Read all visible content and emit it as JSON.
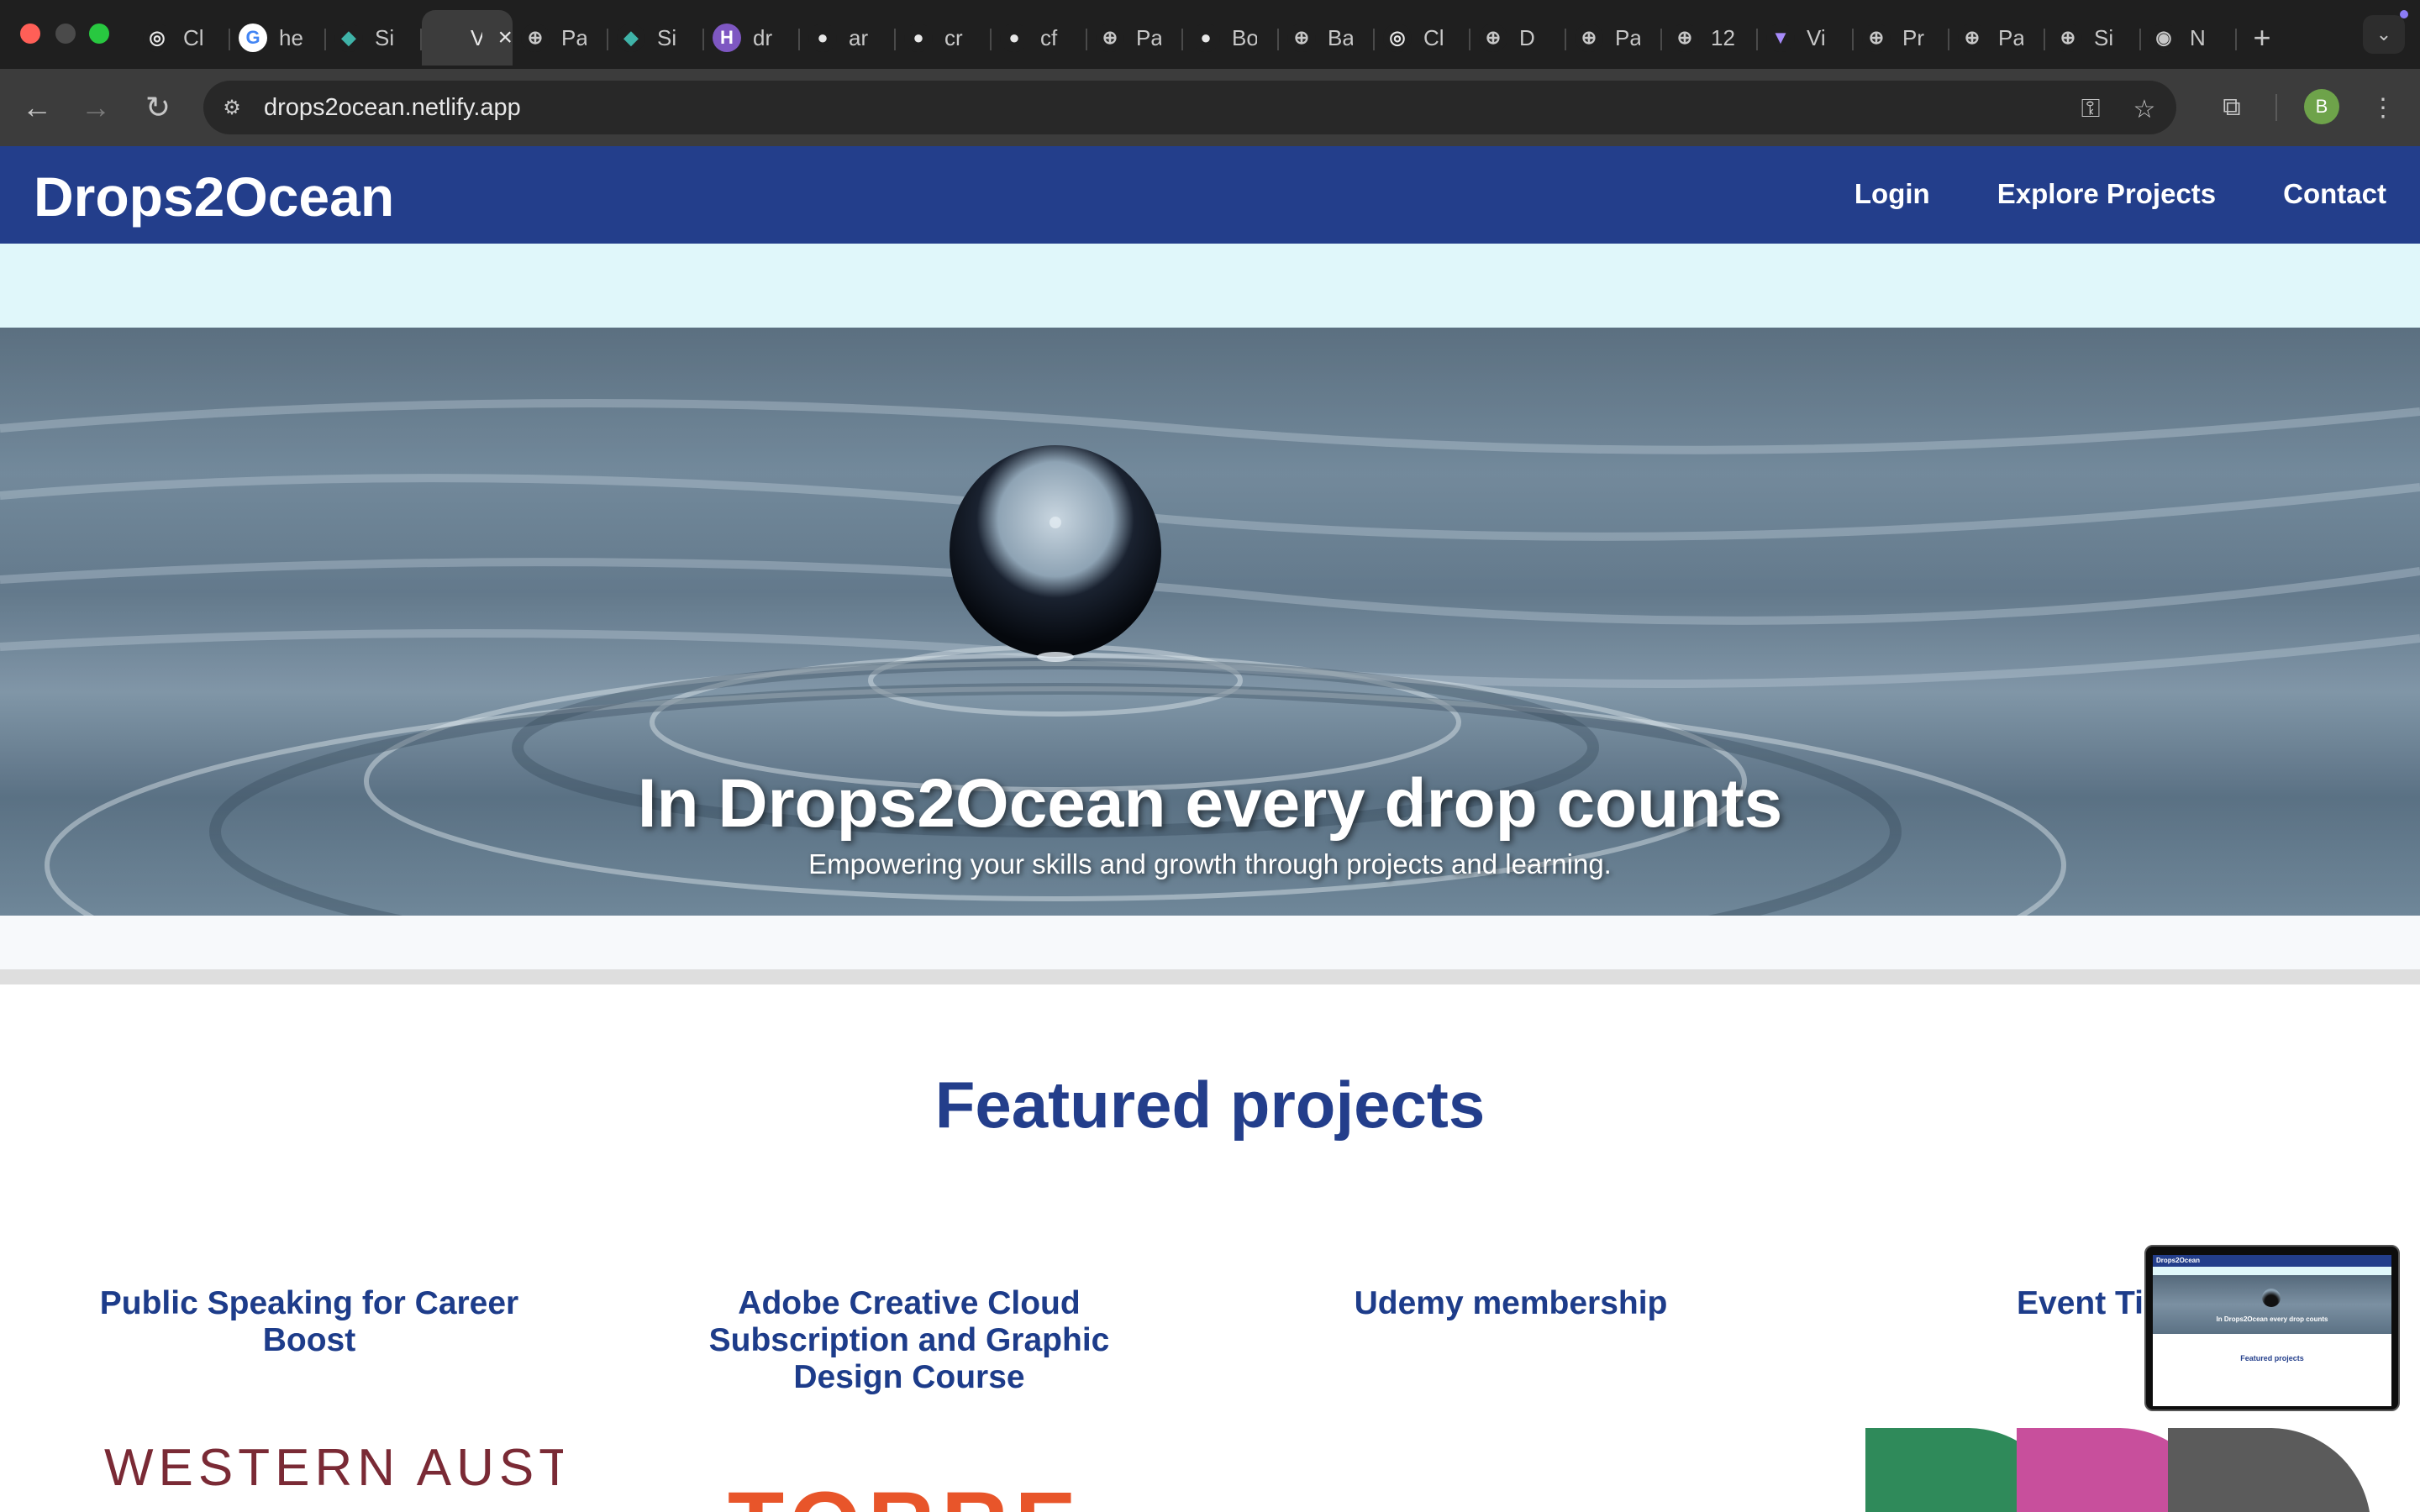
{
  "browser": {
    "tabs": [
      {
        "icon": "openai-icon",
        "glyph": "◎",
        "fav_bg": "#1f1f1f",
        "fav_color": "#e8e8e8",
        "title": "Cl"
      },
      {
        "icon": "google-icon",
        "glyph": "G",
        "fav_bg": "#ffffff",
        "fav_color": "#4285f4",
        "title": "he"
      },
      {
        "icon": "diamond-icon",
        "glyph": "◆",
        "fav_bg": "#1f1f1f",
        "fav_color": "#3fb3a8",
        "title": "Si"
      },
      {
        "icon": "vercel-icon",
        "glyph": "",
        "fav_bg": "#3c3c3c",
        "fav_color": "#e8e8e8",
        "title": "Vi",
        "active": true
      },
      {
        "icon": "globe-icon",
        "glyph": "⊕",
        "fav_bg": "#1f1f1f",
        "fav_color": "#c7c7c7",
        "title": "Pa"
      },
      {
        "icon": "diamond-icon",
        "glyph": "◆",
        "fav_bg": "#1f1f1f",
        "fav_color": "#3fb3a8",
        "title": "Si"
      },
      {
        "icon": "h-app-icon",
        "glyph": "H",
        "fav_bg": "#7e57c2",
        "fav_color": "#ffffff",
        "title": "dr"
      },
      {
        "icon": "github-icon",
        "glyph": "●",
        "fav_bg": "#1f1f1f",
        "fav_color": "#e8e8e8",
        "title": "ar"
      },
      {
        "icon": "github-icon",
        "glyph": "●",
        "fav_bg": "#1f1f1f",
        "fav_color": "#e8e8e8",
        "title": "cr"
      },
      {
        "icon": "github-icon",
        "glyph": "●",
        "fav_bg": "#1f1f1f",
        "fav_color": "#e8e8e8",
        "title": "cf"
      },
      {
        "icon": "globe-icon",
        "glyph": "⊕",
        "fav_bg": "#1f1f1f",
        "fav_color": "#c7c7c7",
        "title": "Pa"
      },
      {
        "icon": "github-icon",
        "glyph": "●",
        "fav_bg": "#1f1f1f",
        "fav_color": "#e8e8e8",
        "title": "Bo"
      },
      {
        "icon": "globe-icon",
        "glyph": "⊕",
        "fav_bg": "#1f1f1f",
        "fav_color": "#c7c7c7",
        "title": "Ba"
      },
      {
        "icon": "openai-icon",
        "glyph": "◎",
        "fav_bg": "#1f1f1f",
        "fav_color": "#e8e8e8",
        "title": "Cl"
      },
      {
        "icon": "globe-icon",
        "glyph": "⊕",
        "fav_bg": "#1f1f1f",
        "fav_color": "#c7c7c7",
        "title": "D"
      },
      {
        "icon": "globe-icon",
        "glyph": "⊕",
        "fav_bg": "#1f1f1f",
        "fav_color": "#c7c7c7",
        "title": "Pa"
      },
      {
        "icon": "globe-icon",
        "glyph": "⊕",
        "fav_bg": "#1f1f1f",
        "fav_color": "#c7c7c7",
        "title": "12"
      },
      {
        "icon": "vite-icon",
        "glyph": "▼",
        "fav_bg": "#1f1f1f",
        "fav_color": "#a78bfa",
        "title": "Vi"
      },
      {
        "icon": "globe-icon",
        "glyph": "⊕",
        "fav_bg": "#1f1f1f",
        "fav_color": "#c7c7c7",
        "title": "Pr"
      },
      {
        "icon": "globe-icon",
        "glyph": "⊕",
        "fav_bg": "#1f1f1f",
        "fav_color": "#c7c7c7",
        "title": "Pa"
      },
      {
        "icon": "globe-icon",
        "glyph": "⊕",
        "fav_bg": "#1f1f1f",
        "fav_color": "#c7c7c7",
        "title": "Si"
      },
      {
        "icon": "chrome-icon",
        "glyph": "◉",
        "fav_bg": "#1f1f1f",
        "fav_color": "#c7c7c7",
        "title": "N"
      }
    ],
    "url": "drops2ocean.netlify.app",
    "profile_initial": "B"
  },
  "site": {
    "brand": "Drops2Ocean",
    "nav": [
      "Login",
      "Explore Projects",
      "Contact"
    ],
    "hero_title": "In Drops2Ocean every drop counts",
    "hero_subtitle": "Empowering your skills and growth through projects and learning.",
    "section_title": "Featured projects",
    "projects": [
      {
        "title": "Public Speaking for Career Boost",
        "image_text": "WESTERN AUSTR"
      },
      {
        "title": "Adobe Creative Cloud Subscription and Graphic Design Course",
        "image_text": "TORRE"
      },
      {
        "title": "Udemy membership",
        "image_text": ""
      },
      {
        "title": "Event Ti",
        "image_text": ""
      }
    ]
  },
  "pip_preview": {
    "brand": "Drops2Ocean",
    "hero_title": "In Drops2Ocean every drop counts",
    "section_title": "Featured projects"
  },
  "colors": {
    "header": "#233e8b",
    "band": "#e0f7fa",
    "accent_text": "#1d3c8a"
  }
}
